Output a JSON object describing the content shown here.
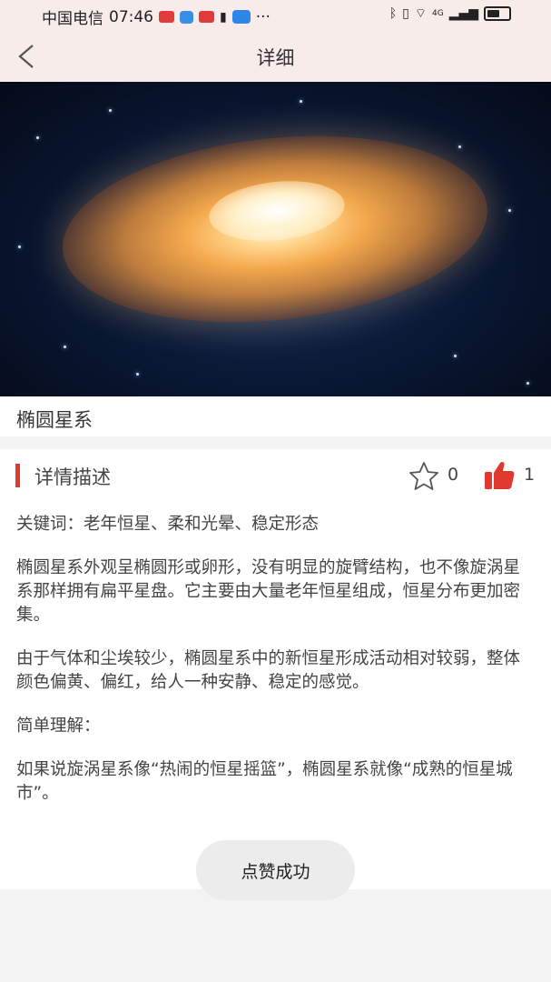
{
  "status_bar": {
    "carrier": "中国电信",
    "time": "07:46",
    "dots": "···",
    "network": "4G"
  },
  "nav": {
    "title": "详细"
  },
  "item": {
    "name": "椭圆星系"
  },
  "detail": {
    "section_title": "详情描述",
    "favorite_count": "0",
    "like_count": "1",
    "keywords": "关键词：老年恒星、柔和光晕、稳定形态",
    "paragraph1": "椭圆星系外观呈椭圆形或卵形，没有明显的旋臂结构，也不像旋涡星系那样拥有扁平星盘。它主要由大量老年恒星组成，恒星分布更加密集。",
    "paragraph2": "由于气体和尘埃较少，椭圆星系中的新恒星形成活动相对较弱，整体颜色偏黄、偏红，给人一种安静、稳定的感觉。",
    "summary_label": "简单理解：",
    "summary": "如果说旋涡星系像“热闹的恒星摇篮”，椭圆星系就像“成熟的恒星城市”。"
  },
  "toast": {
    "message": "点赞成功"
  },
  "colors": {
    "accent": "#e03a30",
    "header_bg": "#f7ece9"
  }
}
